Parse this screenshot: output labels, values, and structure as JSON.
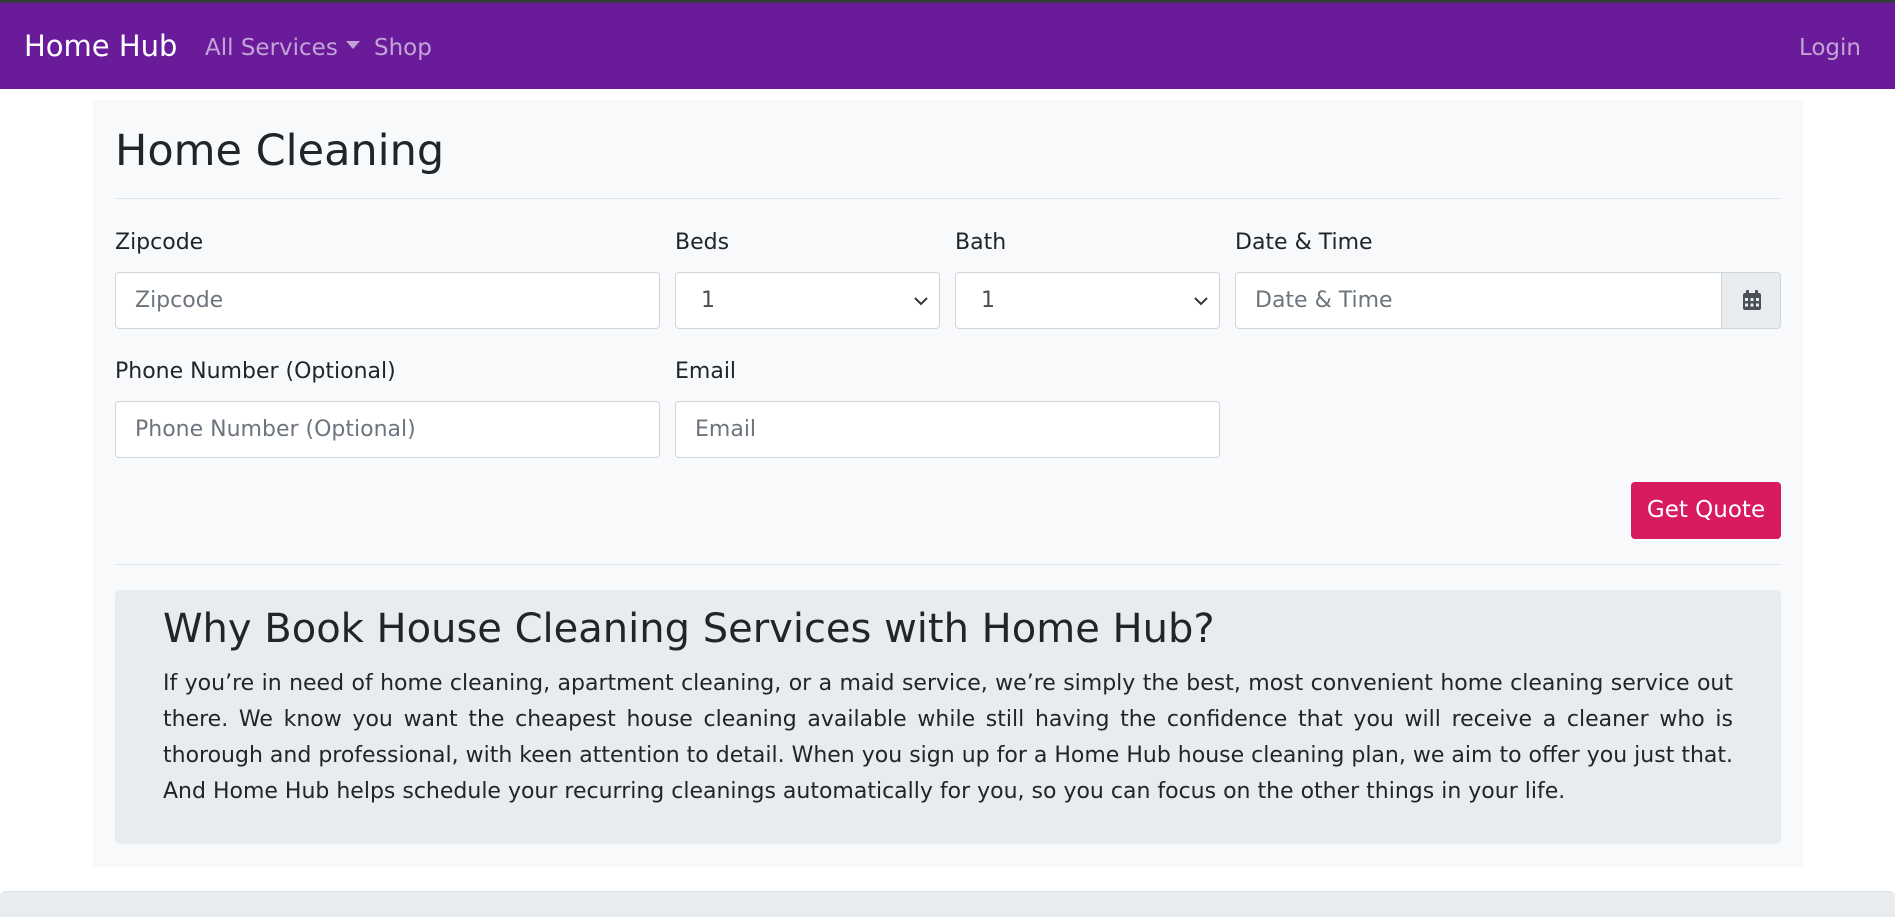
{
  "navbar": {
    "brand": "Home Hub",
    "services_label": "All Services",
    "shop_label": "Shop",
    "login_label": "Login",
    "background_color": "#6a1b9a"
  },
  "page": {
    "title": "Home Cleaning"
  },
  "form": {
    "zipcode": {
      "label": "Zipcode",
      "placeholder": "Zipcode",
      "value": ""
    },
    "beds": {
      "label": "Beds",
      "selected": "1"
    },
    "bath": {
      "label": "Bath",
      "selected": "1"
    },
    "datetime": {
      "label": "Date & Time",
      "placeholder": "Date & Time",
      "value": "",
      "icon": "calendar-icon"
    },
    "phone": {
      "label": "Phone Number (Optional)",
      "placeholder": "Phone Number (Optional)",
      "value": ""
    },
    "email": {
      "label": "Email",
      "placeholder": "Email",
      "value": ""
    },
    "submit_label": "Get Quote",
    "submit_color": "#d81b60"
  },
  "info": {
    "heading": "Why Book House Cleaning Services with Home Hub?",
    "body": "If you’re in need of home cleaning, apartment cleaning, or a maid service, we’re simply the best, most convenient home cleaning service out there. We know you want the cheapest house cleaning available while still having the confidence that you will receive a cleaner who is thorough and professional, with keen attention to detail. When you sign up for a Home Hub house cleaning plan, we aim to offer you just that. And Home Hub helps schedule your recurring cleanings automatically for you, so you can focus on the other things in your life."
  }
}
